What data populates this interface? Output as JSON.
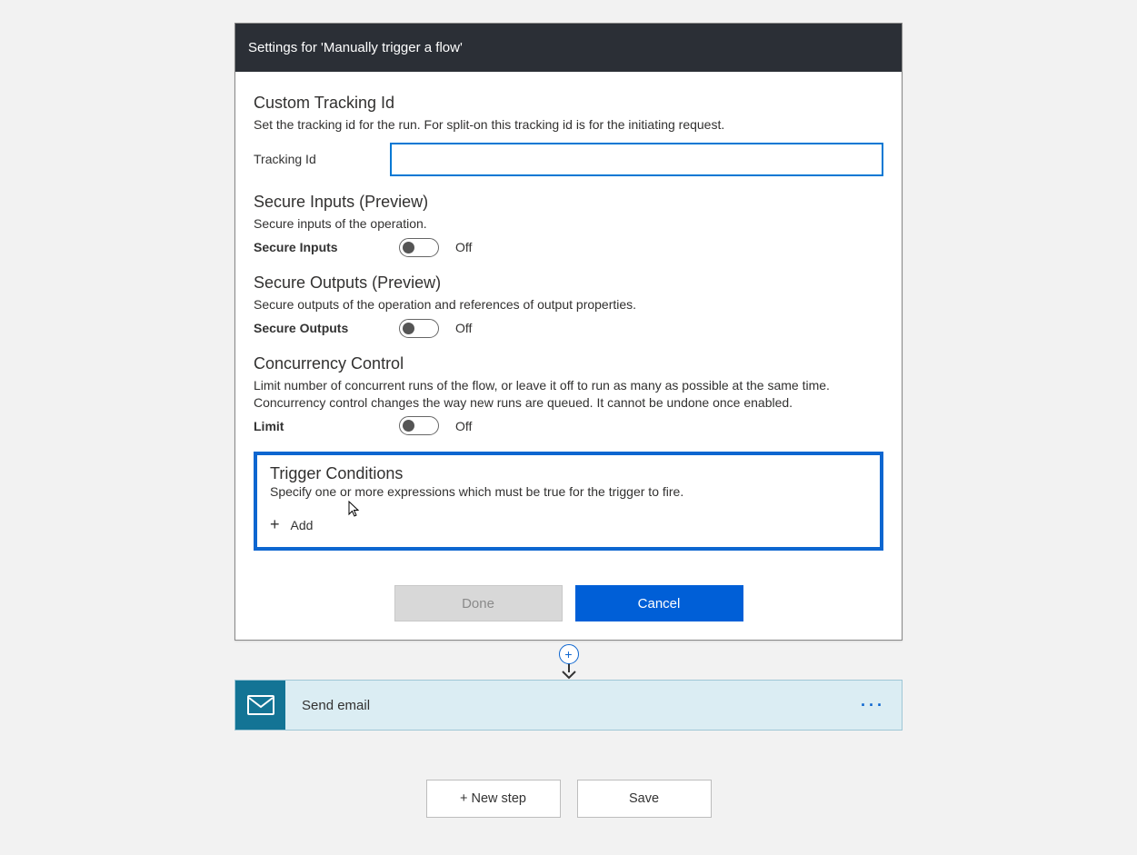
{
  "header": {
    "title": "Settings for 'Manually trigger a flow'"
  },
  "sections": {
    "tracking": {
      "title": "Custom Tracking Id",
      "desc": "Set the tracking id for the run. For split-on this tracking id is for the initiating request.",
      "label": "Tracking Id",
      "value": ""
    },
    "secure_inputs": {
      "title": "Secure Inputs (Preview)",
      "desc": "Secure inputs of the operation.",
      "toggle_label": "Secure Inputs",
      "state": "Off"
    },
    "secure_outputs": {
      "title": "Secure Outputs (Preview)",
      "desc": "Secure outputs of the operation and references of output properties.",
      "toggle_label": "Secure Outputs",
      "state": "Off"
    },
    "concurrency": {
      "title": "Concurrency Control",
      "desc": "Limit number of concurrent runs of the flow, or leave it off to run as many as possible at the same time. Concurrency control changes the way new runs are queued. It cannot be undone once enabled.",
      "toggle_label": "Limit",
      "state": "Off"
    },
    "trigger_conditions": {
      "title": "Trigger Conditions",
      "desc": "Specify one or more expressions which must be true for the trigger to fire.",
      "add_label": "Add"
    }
  },
  "footer": {
    "done": "Done",
    "cancel": "Cancel"
  },
  "action": {
    "title": "Send email"
  },
  "bottom": {
    "new_step": "+ New step",
    "save": "Save"
  }
}
